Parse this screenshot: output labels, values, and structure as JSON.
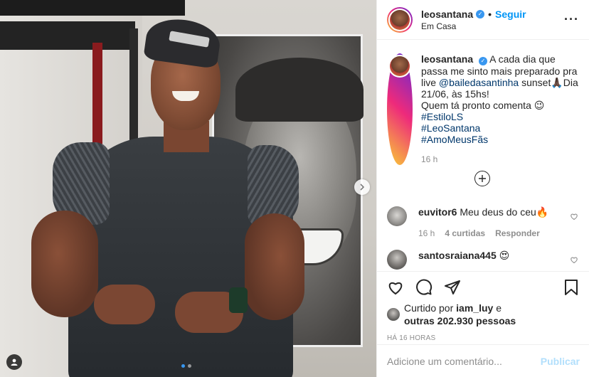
{
  "post": {
    "author": {
      "username": "leosantana",
      "verified": true,
      "location": "Em Casa",
      "follow_label": "Seguir"
    },
    "media": {
      "carousel_count": 2,
      "active_index": 0
    },
    "caption": {
      "username": "leosantana",
      "line1": "A cada dia que passa me sinto mais preparado pra live",
      "mention": "@bailedasantinha",
      "line2": "sunset🙏🏿Dia 21/06, às 15hs!",
      "line3": "Quem tá pronto comenta 😉",
      "hashtags": [
        "#EstiloLS",
        "#LeoSantana",
        "#AmoMeusFãs"
      ],
      "time": "16 h"
    },
    "comments": [
      {
        "username": "euvitor6",
        "text": "Meu deus do ceu🔥",
        "time": "16 h",
        "likes": "4 curtidas",
        "reply_label": "Responder"
      },
      {
        "username": "santosraiana445",
        "text": "😍"
      }
    ],
    "likes": {
      "prefix": "Curtido por",
      "liker": "iam_luy",
      "conj": "e",
      "others": "outras 202.930 pessoas"
    },
    "time_ago": "HÁ 16 HORAS",
    "add_comment": {
      "placeholder": "Adicione um comentário...",
      "publish_label": "Publicar"
    },
    "colors": {
      "accent": "#0095f6",
      "publish_disabled": "#b2dffc",
      "link": "#00376b",
      "muted": "#8e8e8e"
    }
  }
}
